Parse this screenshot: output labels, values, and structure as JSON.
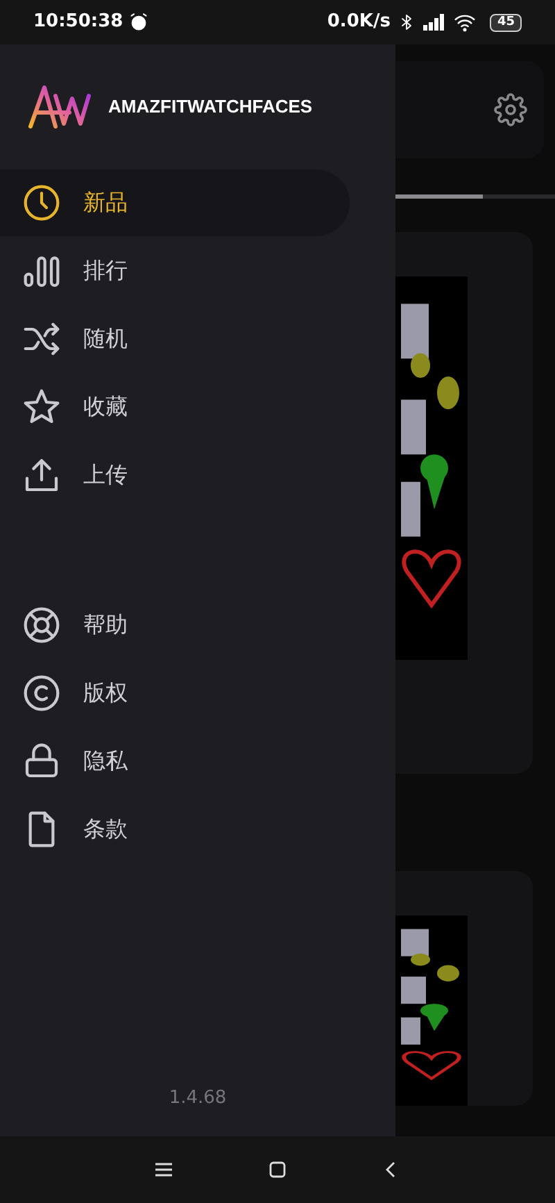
{
  "status_bar": {
    "time": "10:50:38",
    "network_speed": "0.0K/s",
    "battery": "45"
  },
  "drawer": {
    "app_name": "AMAZFITWATCHFACES",
    "main_items": [
      {
        "label": "新品",
        "selected": true
      },
      {
        "label": "排行",
        "selected": false
      },
      {
        "label": "随机",
        "selected": false
      },
      {
        "label": "收藏",
        "selected": false
      },
      {
        "label": "上传",
        "selected": false
      }
    ],
    "info_items": [
      {
        "label": "帮助",
        "selected": false
      },
      {
        "label": "版权",
        "selected": false
      },
      {
        "label": "隐私",
        "selected": false
      },
      {
        "label": "条款",
        "selected": false
      }
    ],
    "version": "1.4.68"
  },
  "background": {
    "tab_indicator": {
      "level": 0.55
    }
  }
}
